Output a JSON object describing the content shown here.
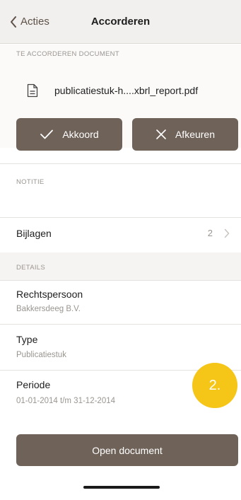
{
  "nav": {
    "back_label": "Acties",
    "title": "Accorderen"
  },
  "document_section": {
    "label": "TE ACCORDEREN DOCUMENT",
    "file_name": "publicatiestuk-h....xbrl_report.pdf"
  },
  "actions": {
    "approve_label": "Akkoord",
    "reject_label": "Afkeuren"
  },
  "note_section": {
    "label": "NOTITIE"
  },
  "attachments": {
    "label": "Bijlagen",
    "count": "2"
  },
  "details_section": {
    "label": "DETAILS"
  },
  "details": [
    {
      "label": "Rechtspersoon",
      "value": "Bakkersdeeg B.V."
    },
    {
      "label": "Type",
      "value": "Publicatiestuk"
    },
    {
      "label": "Periode",
      "value": "01-01-2014 t/m 31-12-2014"
    }
  ],
  "open_button_label": "Open document",
  "step_badge": "2.",
  "colors": {
    "primary_button": "#6f6259",
    "badge": "#f5c518",
    "nav_bg": "#f2f0ee",
    "band_bg": "#f6f4f2"
  },
  "icons": [
    "chevron-left-icon",
    "document-icon",
    "checkmark-icon",
    "close-icon",
    "chevron-right-icon"
  ]
}
